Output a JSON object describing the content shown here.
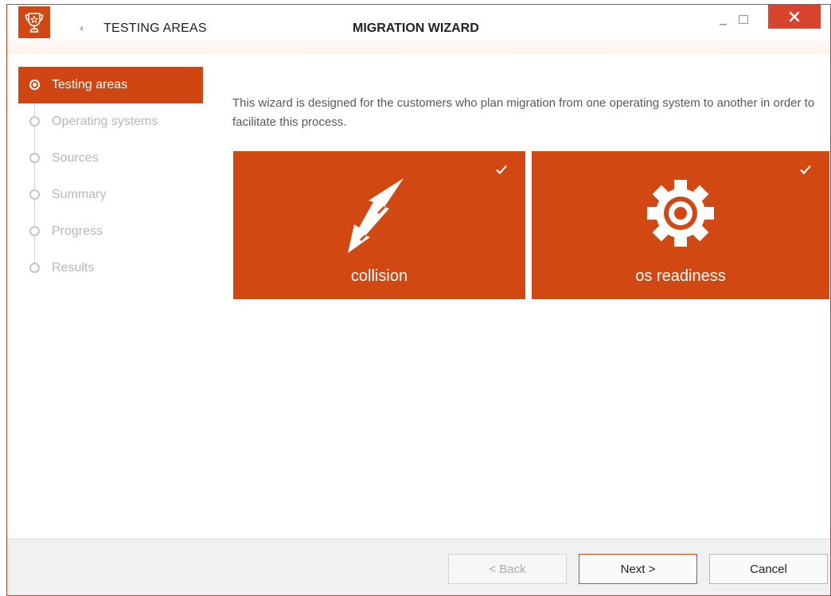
{
  "window": {
    "section_title": "TESTING AREAS",
    "title": "MIGRATION WIZARD",
    "accent_color": "#d24813",
    "close_color": "#d9442e"
  },
  "steps": [
    {
      "label": "Testing areas",
      "state": "active"
    },
    {
      "label": "Operating systems",
      "state": "inactive"
    },
    {
      "label": "Sources",
      "state": "inactive"
    },
    {
      "label": "Summary",
      "state": "inactive"
    },
    {
      "label": "Progress",
      "state": "inactive"
    },
    {
      "label": "Results",
      "state": "inactive"
    }
  ],
  "description": "This wizard is designed for the customers who plan migration from one operating system to another in order to facilitate this process.",
  "tiles": [
    {
      "label": "collision",
      "icon": "lightning-icon",
      "selected": true
    },
    {
      "label": "os readiness",
      "icon": "gear-icon",
      "selected": true
    }
  ],
  "footer": {
    "back_label": "< Back",
    "next_label": "Next >",
    "cancel_label": "Cancel"
  }
}
